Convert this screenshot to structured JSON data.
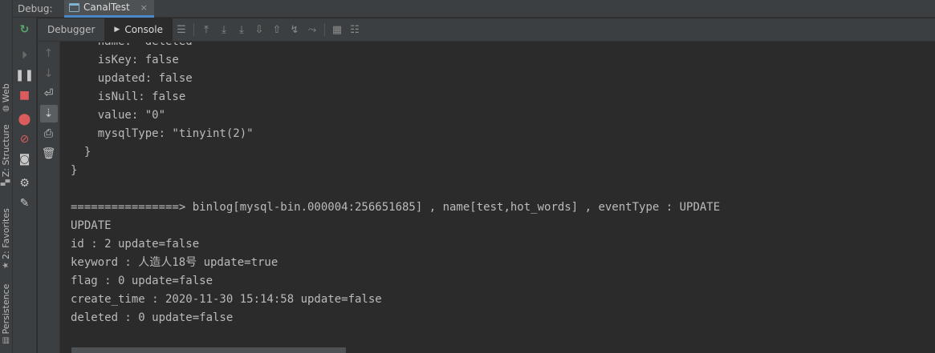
{
  "header": {
    "debug_label": "Debug:",
    "run_tab_label": "CanalTest",
    "close_glyph": "×"
  },
  "tabs": {
    "debugger": "Debugger",
    "console": "Console"
  },
  "stripe": {
    "web": "Web",
    "structure": "Z: Structure",
    "favorites": "2: Favorites",
    "persistence": "Persistence"
  },
  "console_lines": [
    "    name: \"deleted\"",
    "    isKey: false",
    "    updated: false",
    "    isNull: false",
    "    value: \"0\"",
    "    mysqlType: \"tinyint(2)\"",
    "  }",
    "}",
    "",
    "================> binlog[mysql-bin.000004:256651685] , name[test,hot_words] , eventType : UPDATE",
    "UPDATE",
    "id : 2 update=false",
    "keyword : 人造人18号 update=true",
    "flag : 0 update=false",
    "create_time : 2020-11-30 15:14:58 update=false",
    "deleted : 0 update=false"
  ],
  "colors": {
    "accent": "#4a88c7",
    "rerun": "#59a869",
    "stop": "#db5c5c",
    "background": "#2b2b2b",
    "panel": "#3c3f41"
  },
  "icons": {
    "rerun": "rerun-icon",
    "resume": "resume-icon",
    "pause": "pause-icon",
    "stop": "stop-icon",
    "breakpoints": "view-breakpoints-icon",
    "mute": "mute-breakpoints-icon",
    "camera": "camera-icon",
    "settings": "settings-icon",
    "pin": "pin-icon"
  }
}
